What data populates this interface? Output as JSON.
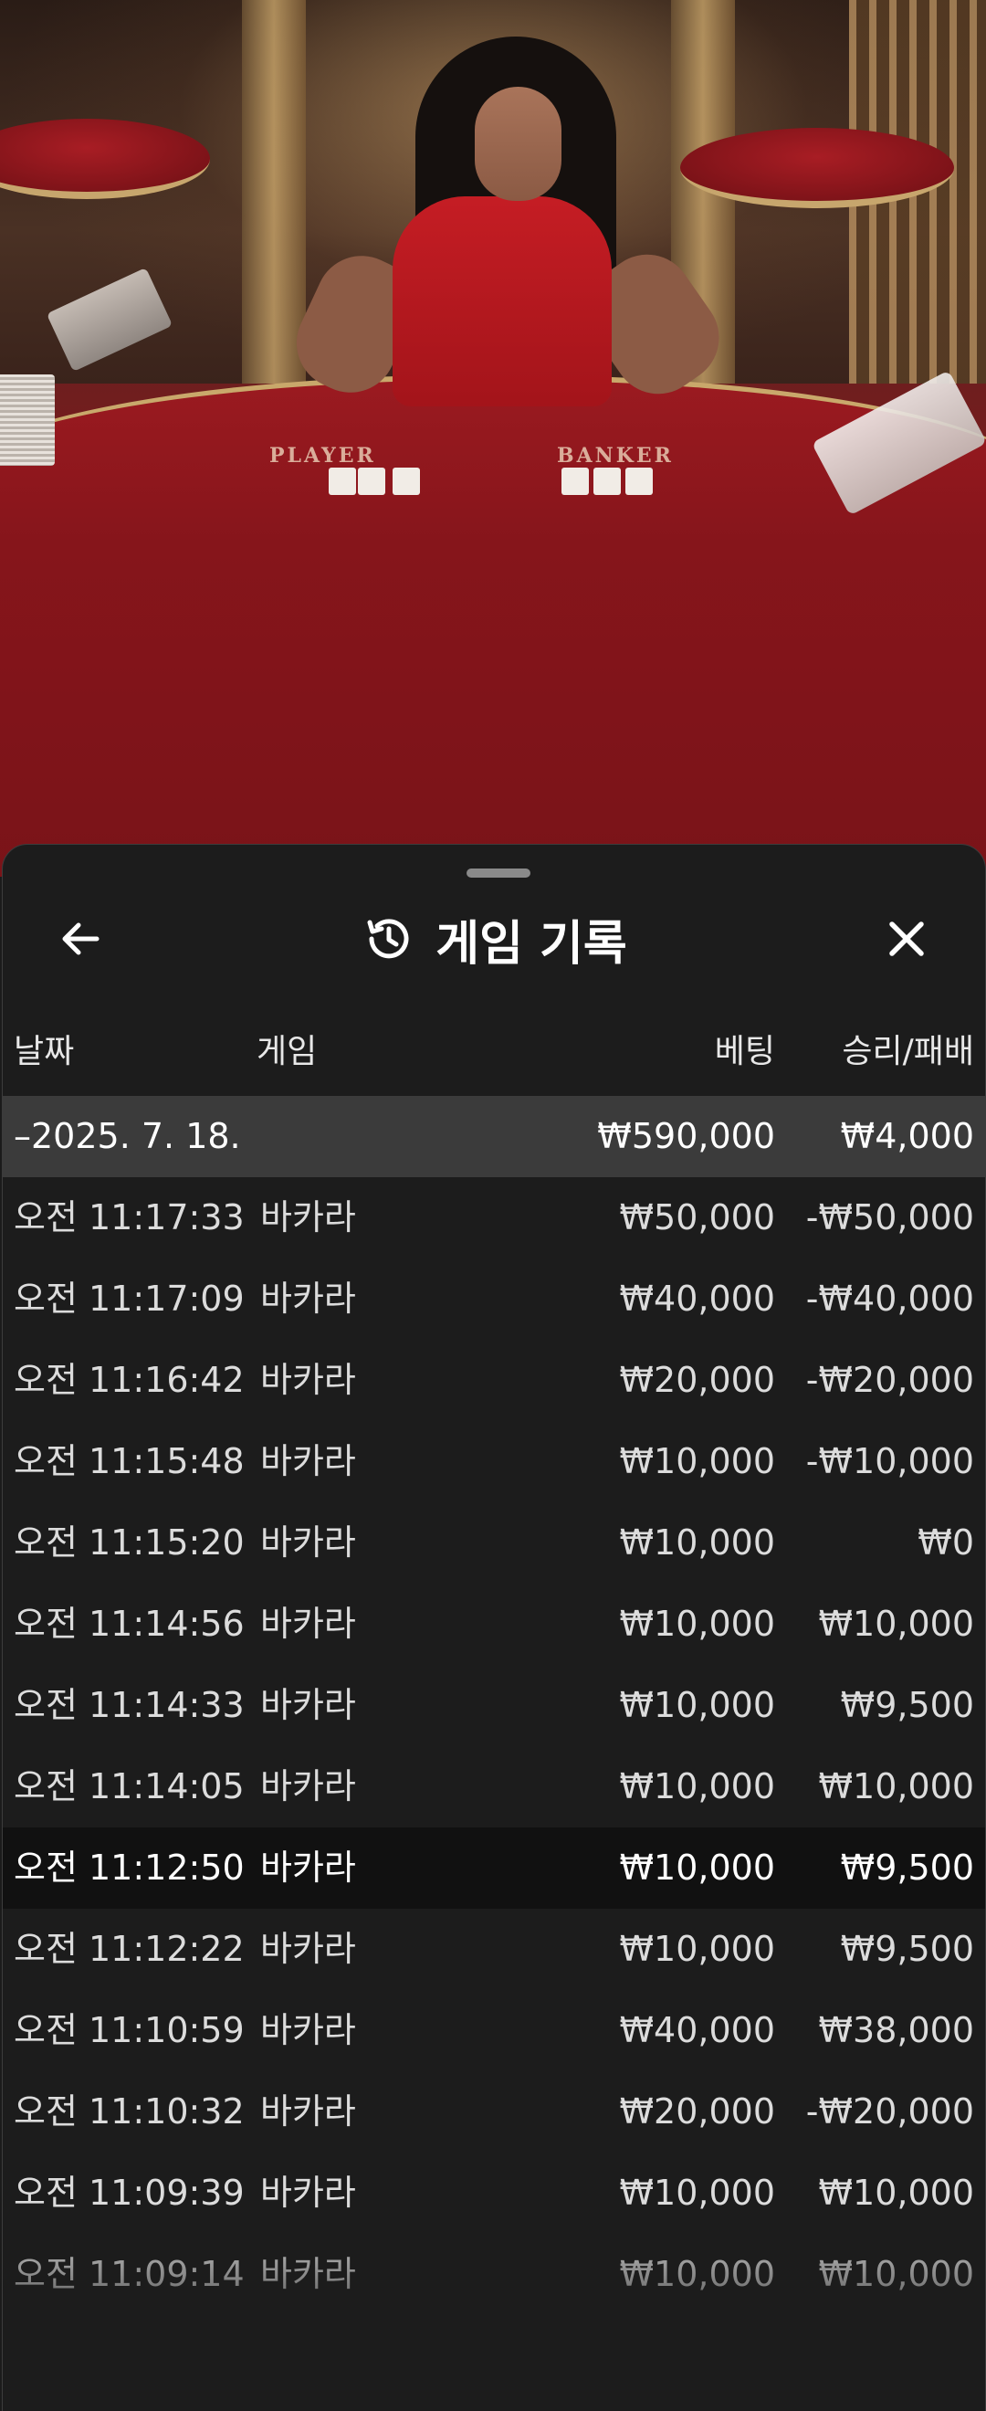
{
  "video": {
    "table_labels": {
      "player": "PLAYER",
      "banker": "BANKER"
    }
  },
  "sheet": {
    "title": "게임 기록",
    "icons": {
      "back": "arrow-left-icon",
      "history": "history-clock-icon",
      "close": "close-icon"
    },
    "columns": {
      "date": "날짜",
      "game": "게임",
      "bet": "베팅",
      "winloss": "승리/패배"
    },
    "summary": {
      "date": "–2025. 7. 18.",
      "bet": "₩590,000",
      "winloss": "₩4,000"
    },
    "rows": [
      {
        "time": "오전 11:17:33",
        "game": "바카라",
        "bet": "₩50,000",
        "winloss": "-₩50,000"
      },
      {
        "time": "오전 11:17:09",
        "game": "바카라",
        "bet": "₩40,000",
        "winloss": "-₩40,000"
      },
      {
        "time": "오전 11:16:42",
        "game": "바카라",
        "bet": "₩20,000",
        "winloss": "-₩20,000"
      },
      {
        "time": "오전 11:15:48",
        "game": "바카라",
        "bet": "₩10,000",
        "winloss": "-₩10,000"
      },
      {
        "time": "오전 11:15:20",
        "game": "바카라",
        "bet": "₩10,000",
        "winloss": "₩0"
      },
      {
        "time": "오전 11:14:56",
        "game": "바카라",
        "bet": "₩10,000",
        "winloss": "₩10,000"
      },
      {
        "time": "오전 11:14:33",
        "game": "바카라",
        "bet": "₩10,000",
        "winloss": "₩9,500"
      },
      {
        "time": "오전 11:14:05",
        "game": "바카라",
        "bet": "₩10,000",
        "winloss": "₩10,000"
      },
      {
        "time": "오전 11:12:50",
        "game": "바카라",
        "bet": "₩10,000",
        "winloss": "₩9,500"
      },
      {
        "time": "오전 11:12:22",
        "game": "바카라",
        "bet": "₩10,000",
        "winloss": "₩9,500"
      },
      {
        "time": "오전 11:10:59",
        "game": "바카라",
        "bet": "₩40,000",
        "winloss": "₩38,000"
      },
      {
        "time": "오전 11:10:32",
        "game": "바카라",
        "bet": "₩20,000",
        "winloss": "-₩20,000"
      },
      {
        "time": "오전 11:09:39",
        "game": "바카라",
        "bet": "₩10,000",
        "winloss": "₩10,000"
      },
      {
        "time": "오전 11:09:14",
        "game": "바카라",
        "bet": "₩10,000",
        "winloss": "₩10,000"
      }
    ],
    "highlighted_row_index": 8
  }
}
